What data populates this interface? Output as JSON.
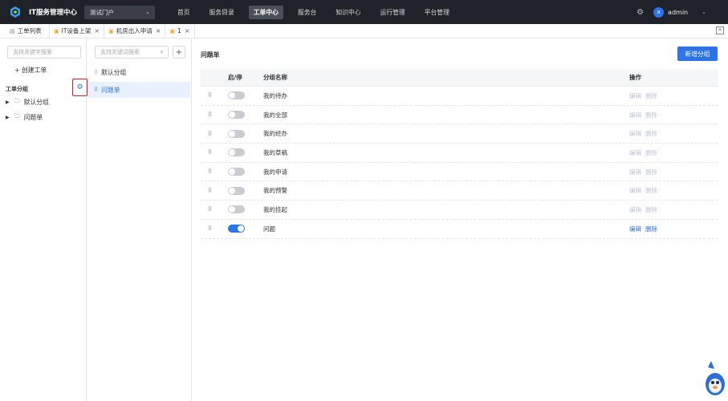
{
  "app": {
    "title": "IT服务管理中心",
    "portal": "测试门户"
  },
  "nav": {
    "items": [
      {
        "label": "首页",
        "active": false
      },
      {
        "label": "服务目录",
        "active": false
      },
      {
        "label": "工单中心",
        "active": true
      },
      {
        "label": "服务台",
        "active": false
      },
      {
        "label": "知识中心",
        "active": false
      },
      {
        "label": "运行管理",
        "active": false
      },
      {
        "label": "平台管理",
        "active": false
      }
    ]
  },
  "user": {
    "avatar_letter": "a",
    "name": "admin"
  },
  "tabs": [
    {
      "label": "工单列表"
    },
    {
      "label": "IT设备上架"
    },
    {
      "label": "机房出入申请"
    },
    {
      "label": "1"
    }
  ],
  "left": {
    "search_placeholder": "支持关键字搜索",
    "create_label": "+ 创建工单",
    "section_title": "工单分组",
    "tree": [
      {
        "label": "默认分组"
      },
      {
        "label": "问题单"
      }
    ]
  },
  "middle": {
    "search_placeholder": "支持关键词搜索",
    "plus": "+",
    "groups": [
      {
        "label": "默认分组",
        "selected": false
      },
      {
        "label": "问题单",
        "selected": true
      }
    ]
  },
  "main": {
    "title": "问题单",
    "add_button": "新增分组",
    "columns": {
      "toggle": "启/停",
      "name": "分组名称",
      "ops": "操作"
    },
    "rows": [
      {
        "name": "我的待办",
        "enabled": false
      },
      {
        "name": "我的全部",
        "enabled": false
      },
      {
        "name": "我的经办",
        "enabled": false
      },
      {
        "name": "我的草稿",
        "enabled": false
      },
      {
        "name": "我的申请",
        "enabled": false
      },
      {
        "name": "我的预警",
        "enabled": false
      },
      {
        "name": "我的挂起",
        "enabled": false
      },
      {
        "name": "问题",
        "enabled": true
      }
    ],
    "edit_label": "编辑",
    "delete_label": "删除"
  },
  "colors": {
    "accent": "#2b73e6",
    "topbar": "#1f2329",
    "highlight": "#e02020"
  }
}
